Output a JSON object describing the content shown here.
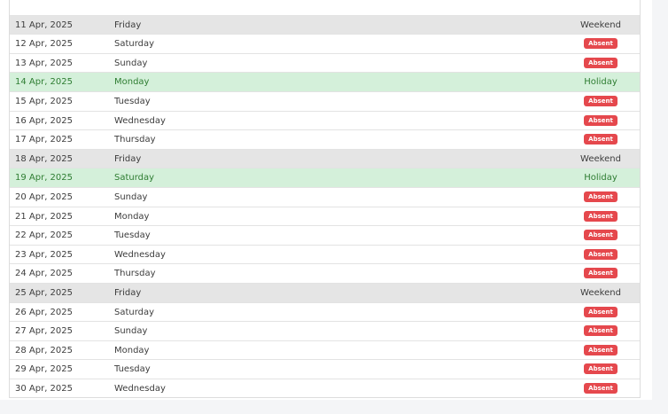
{
  "rows": [
    {
      "date": "",
      "day": "",
      "status": "",
      "type": "normal"
    },
    {
      "date": "11 Apr, 2025",
      "day": "Friday",
      "status": "Weekend",
      "type": "weekend"
    },
    {
      "date": "12 Apr, 2025",
      "day": "Saturday",
      "status": "Absent",
      "type": "absent"
    },
    {
      "date": "13 Apr, 2025",
      "day": "Sunday",
      "status": "Absent",
      "type": "absent"
    },
    {
      "date": "14 Apr, 2025",
      "day": "Monday",
      "status": "Holiday",
      "type": "holiday"
    },
    {
      "date": "15 Apr, 2025",
      "day": "Tuesday",
      "status": "Absent",
      "type": "absent"
    },
    {
      "date": "16 Apr, 2025",
      "day": "Wednesday",
      "status": "Absent",
      "type": "absent"
    },
    {
      "date": "17 Apr, 2025",
      "day": "Thursday",
      "status": "Absent",
      "type": "absent"
    },
    {
      "date": "18 Apr, 2025",
      "day": "Friday",
      "status": "Weekend",
      "type": "weekend"
    },
    {
      "date": "19 Apr, 2025",
      "day": "Saturday",
      "status": "Holiday",
      "type": "holiday"
    },
    {
      "date": "20 Apr, 2025",
      "day": "Sunday",
      "status": "Absent",
      "type": "absent"
    },
    {
      "date": "21 Apr, 2025",
      "day": "Monday",
      "status": "Absent",
      "type": "absent"
    },
    {
      "date": "22 Apr, 2025",
      "day": "Tuesday",
      "status": "Absent",
      "type": "absent"
    },
    {
      "date": "23 Apr, 2025",
      "day": "Wednesday",
      "status": "Absent",
      "type": "absent"
    },
    {
      "date": "24 Apr, 2025",
      "day": "Thursday",
      "status": "Absent",
      "type": "absent"
    },
    {
      "date": "25 Apr, 2025",
      "day": "Friday",
      "status": "Weekend",
      "type": "weekend"
    },
    {
      "date": "26 Apr, 2025",
      "day": "Saturday",
      "status": "Absent",
      "type": "absent"
    },
    {
      "date": "27 Apr, 2025",
      "day": "Sunday",
      "status": "Absent",
      "type": "absent"
    },
    {
      "date": "28 Apr, 2025",
      "day": "Monday",
      "status": "Absent",
      "type": "absent"
    },
    {
      "date": "29 Apr, 2025",
      "day": "Tuesday",
      "status": "Absent",
      "type": "absent"
    },
    {
      "date": "30 Apr, 2025",
      "day": "Wednesday",
      "status": "Absent",
      "type": "absent"
    }
  ],
  "colors": {
    "weekend_row": "#e5e5e5",
    "holiday_row": "#d4f0da",
    "holiday_text": "#2e7d32",
    "absent_badge": "#e5484d"
  }
}
